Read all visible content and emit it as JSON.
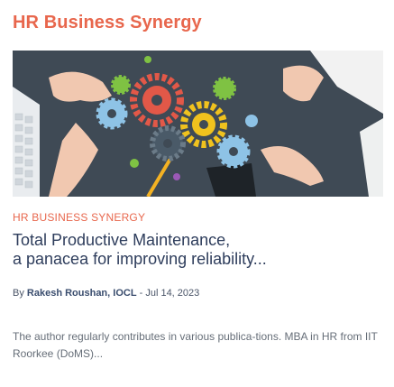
{
  "section": {
    "title": "HR Business Synergy"
  },
  "hero": {
    "alt": "Hands assembling colorful gear cogs on a desk"
  },
  "article": {
    "category": "HR BUSINESS SYNERGY",
    "title_line1": "Total Productive Maintenance,",
    "title_line2": "a panacea for improving reliability...",
    "byline_prefix": "By ",
    "author": "Rakesh Roushan, IOCL",
    "byline_separator": " - ",
    "date": "Jul 14, 2023",
    "excerpt": "The author regularly contributes in various publica-tions. MBA in HR from IIT Roorkee (DoMS)..."
  },
  "colors": {
    "accent": "#e8674d",
    "title": "#2e3d5c",
    "hero_bg": "#3f4a55"
  }
}
